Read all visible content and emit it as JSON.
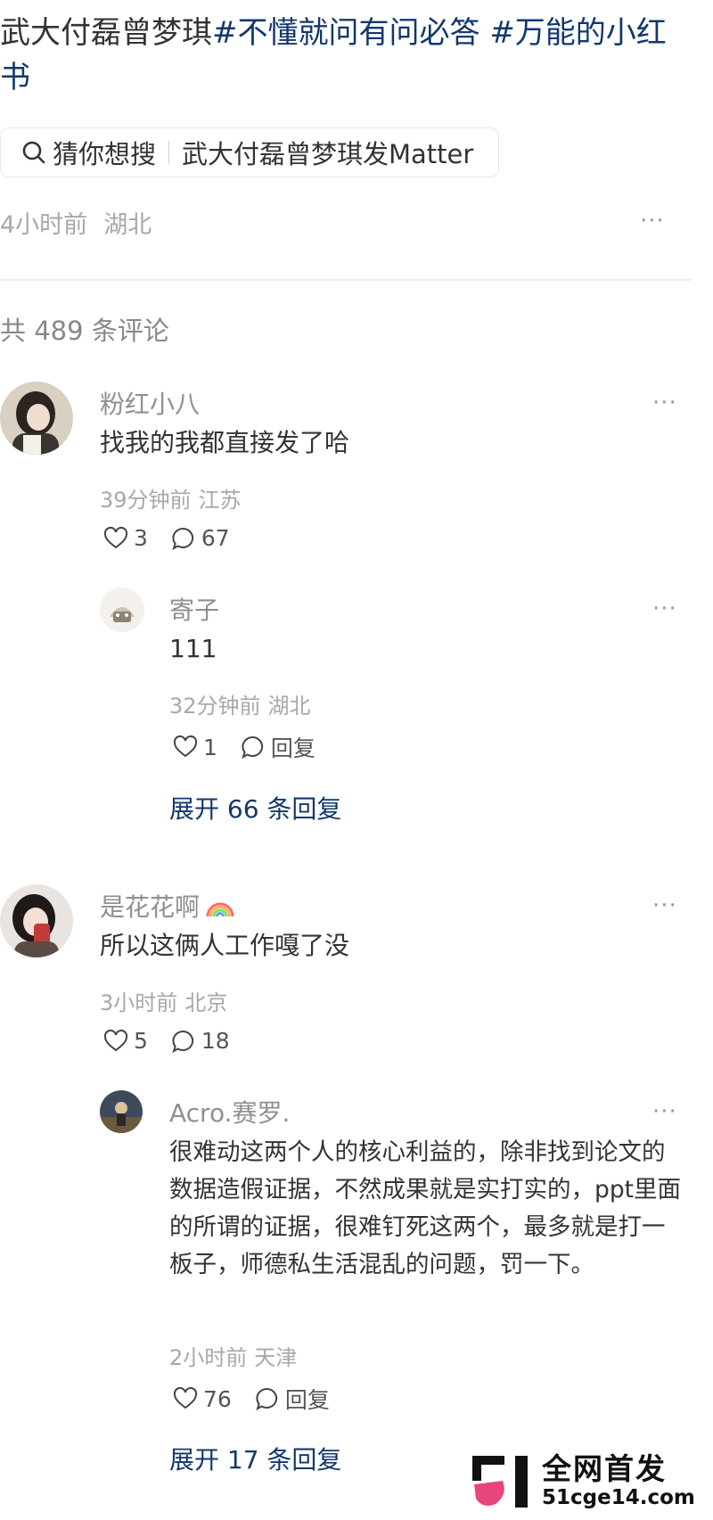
{
  "post": {
    "title_prefix": "武大付磊曾梦琪",
    "tag1": "#不懂就问有问必答",
    "tag2": "#万能的小红书",
    "search_chip": {
      "icon": "search-icon",
      "label": "猜你想搜",
      "query": "武大付磊曾梦琪发Matter"
    },
    "time": "4小时前",
    "location": "湖北",
    "more": "···"
  },
  "comments_total": "共 489 条评论",
  "comments": [
    {
      "user": "粉红小八",
      "text": "找我的我都直接发了哈",
      "time": "39分钟前",
      "location": "江苏",
      "likes": "3",
      "replies": "67",
      "more": "···",
      "reply": {
        "user": "寄子",
        "text": "111",
        "time": "32分钟前",
        "location": "湖北",
        "likes": "1",
        "reply_label": "回复",
        "more": "···"
      },
      "expand": "展开 66 条回复"
    },
    {
      "user": "是花花啊",
      "text": "所以这俩人工作嘎了没",
      "time": "3小时前",
      "location": "北京",
      "likes": "5",
      "replies": "18",
      "more": "···",
      "reply": {
        "user": "Acro.赛罗.",
        "text": "很难动这两个人的核心利益的，除非找到论文的数据造假证据，不然成果就是实打实的，ppt里面的所谓的证据，很难钉死这两个，最多就是打一板子，师德私生活混乱的问题，罚一下。",
        "time": "2小时前",
        "location": "天津",
        "likes": "76",
        "reply_label": "回复",
        "more": "···"
      },
      "expand": "展开 17 条回复"
    }
  ],
  "watermark": {
    "title": "全网首发",
    "url": "51cge14.com"
  },
  "colors": {
    "tag": "#13386c",
    "muted": "#a8a8a8",
    "text": "#333333"
  }
}
